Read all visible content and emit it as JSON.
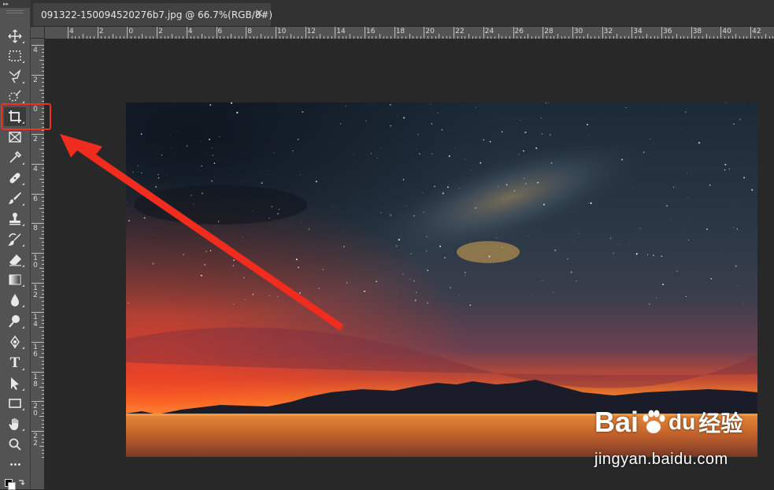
{
  "tab": {
    "title": "091322-150094520276b7.jpg @ 66.7%(RGB/8#)",
    "close": "×"
  },
  "toolbar": {
    "collapse": "▸▸",
    "tools": [
      {
        "name": "move-tool",
        "icon": "move-icon"
      },
      {
        "name": "marquee-tool",
        "icon": "rect-marquee-icon"
      },
      {
        "name": "lasso-tool",
        "icon": "polygon-lasso-icon"
      },
      {
        "name": "quick-select-tool",
        "icon": "quick-select-icon"
      },
      {
        "name": "crop-tool",
        "icon": "crop-icon",
        "active": true
      },
      {
        "name": "frame-tool",
        "icon": "frame-icon"
      },
      {
        "name": "eyedropper-tool",
        "icon": "eyedropper-icon"
      },
      {
        "name": "healing-tool",
        "icon": "bandage-icon"
      },
      {
        "name": "brush-tool",
        "icon": "brush-icon"
      },
      {
        "name": "stamp-tool",
        "icon": "stamp-icon"
      },
      {
        "name": "history-brush-tool",
        "icon": "history-brush-icon"
      },
      {
        "name": "eraser-tool",
        "icon": "eraser-icon"
      },
      {
        "name": "gradient-tool",
        "icon": "gradient-icon"
      },
      {
        "name": "blur-tool",
        "icon": "droplet-icon"
      },
      {
        "name": "dodge-tool",
        "icon": "dodge-icon"
      },
      {
        "name": "pen-tool",
        "icon": "pen-icon"
      },
      {
        "name": "type-tool",
        "icon": "type-icon",
        "glyph": "T"
      },
      {
        "name": "path-select-tool",
        "icon": "arrow-select-icon"
      },
      {
        "name": "shape-tool",
        "icon": "rectangle-icon"
      },
      {
        "name": "hand-tool",
        "icon": "hand-icon"
      },
      {
        "name": "zoom-tool",
        "icon": "magnifier-icon"
      },
      {
        "name": "more-tools",
        "icon": "ellipsis-icon",
        "glyph": "•••"
      }
    ]
  },
  "ruler_top": [
    "4",
    "2",
    "0",
    "2",
    "4",
    "6",
    "8",
    "10",
    "12",
    "14",
    "16",
    "18",
    "20",
    "22",
    "24",
    "26",
    "28",
    "30",
    "32",
    "34",
    "36",
    "38",
    "40",
    "42"
  ],
  "ruler_left": [
    "4",
    "2",
    "0",
    "2",
    "4",
    "6",
    "8",
    "10",
    "12",
    "14",
    "16",
    "18",
    "20",
    "22"
  ],
  "watermark": {
    "brand_latin": "Bai",
    "brand_du": "du",
    "brand_cn": "经验",
    "url": "jingyan.baidu.com"
  },
  "colors": {
    "highlight": "#f03020",
    "arrow": "#f02c1e"
  }
}
